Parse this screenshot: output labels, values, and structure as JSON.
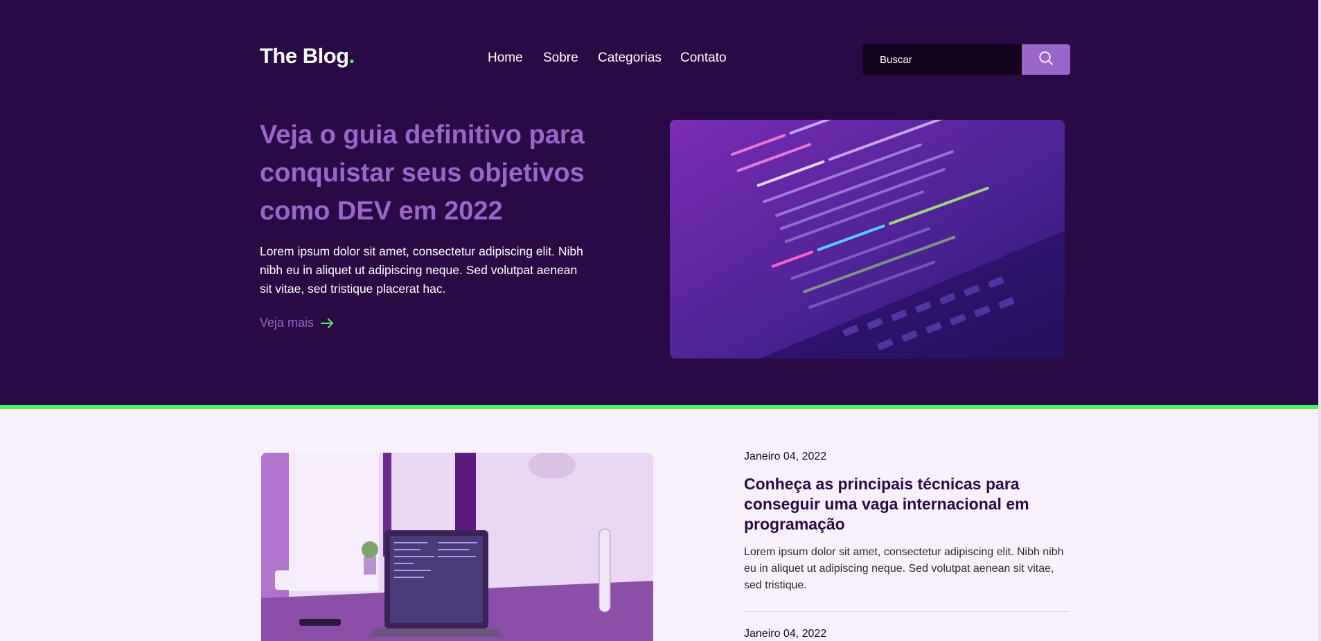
{
  "header": {
    "logo_text": "The Blog",
    "logo_dot": ".",
    "nav": [
      {
        "label": "Home"
      },
      {
        "label": "Sobre"
      },
      {
        "label": "Categorias"
      },
      {
        "label": "Contato"
      }
    ],
    "search": {
      "placeholder": "Buscar",
      "button_icon": "search-icon"
    }
  },
  "hero": {
    "title": "Veja o guia definitivo para conquistar seus objetivos como DEV em 2022",
    "text": "Lorem ipsum dolor sit amet, consectetur adipiscing elit. Nibh nibh eu in aliquet ut adipiscing neque. Sed volutpat aenean sit vitae, sed tristique placerat hac.",
    "link_label": "Veja mais",
    "link_icon": "arrow-right-icon",
    "image": "code-on-laptop-screen-photo"
  },
  "posts": [
    {
      "date": "Janeiro 04, 2022",
      "title": "Conheça as principais técnicas para conseguir uma vaga internacional em programação",
      "excerpt": "Lorem ipsum dolor sit amet, consectetur adipiscing elit. Nibh nibh eu in aliquet ut adipiscing neque. Sed volutpat aenean sit vitae, sed tristique.",
      "image": "laptop-on-desk-photo"
    },
    {
      "date": "Janeiro 04, 2022"
    }
  ],
  "colors": {
    "header_bg": "#2a0a45",
    "accent_purple": "#9a66c9",
    "accent_green": "#4ef55a",
    "page_bg": "#f8f1fb"
  }
}
